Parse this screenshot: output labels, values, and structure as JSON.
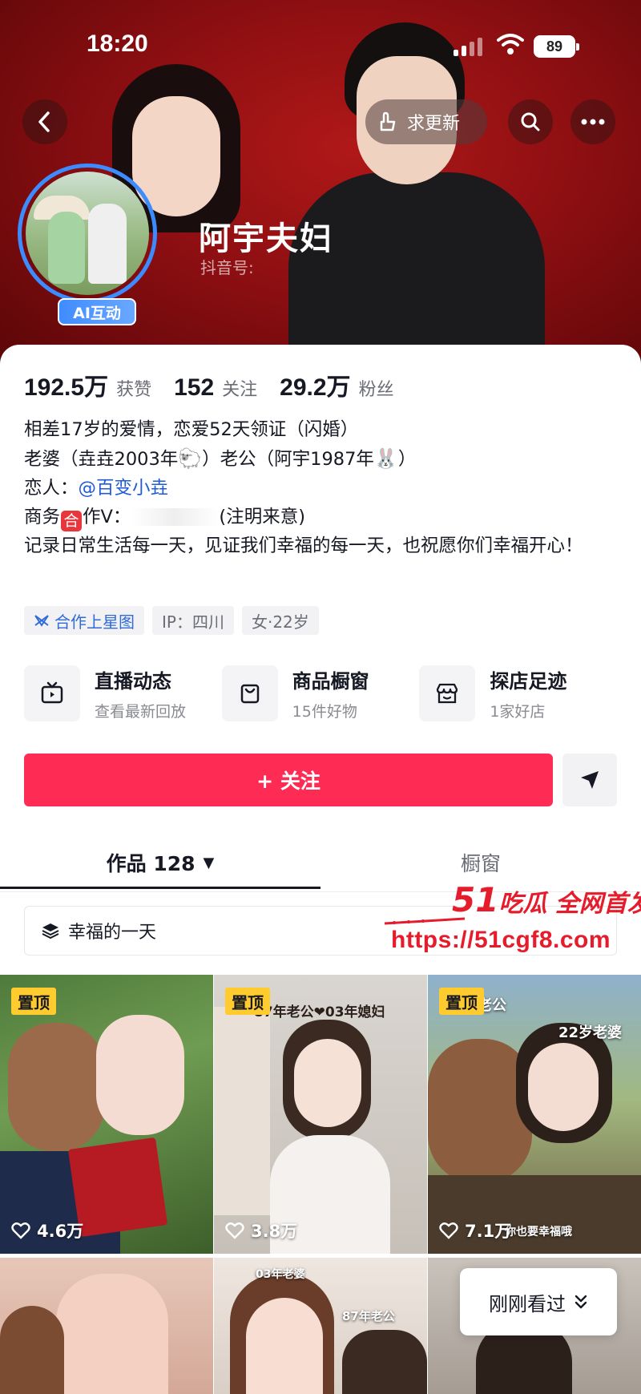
{
  "status_bar": {
    "time": "18:20",
    "battery": "89"
  },
  "top_nav": {
    "request_update_label": "求更新"
  },
  "profile": {
    "display_name": "阿宇夫妇",
    "douyin_id_label": "抖音号:",
    "avatar_badge": "AI互动"
  },
  "stats": [
    {
      "value": "192.5万",
      "label": "获赞"
    },
    {
      "value": "152",
      "label": "关注"
    },
    {
      "value": "29.2万",
      "label": "粉丝"
    }
  ],
  "bio": {
    "line1": "相差17岁的爱情，恋爱52天领证（闪婚）",
    "line2_a": "老婆（垚垚2003年",
    "line2_b": "）老公（阿宇1987年",
    "line2_c": "）",
    "line3_prefix": "恋人：",
    "line3_mention": "@百变小垚",
    "line4_a": "商务",
    "line4_badge": "合",
    "line4_b": "作V：",
    "line4_c": "(注明来意)",
    "line5": "记录日常生活每一天，见证我们幸福的每一天，也祝愿你们幸福开心！"
  },
  "tags": [
    {
      "label": "合作上星图",
      "icon": "star-map-icon"
    },
    {
      "label": "IP：四川"
    },
    {
      "label": "女·22岁"
    }
  ],
  "features": [
    {
      "title": "直播动态",
      "subtitle": "查看最新回放",
      "icon": "tv-icon"
    },
    {
      "title": "商品橱窗",
      "subtitle": "15件好物",
      "icon": "shopping-bag-icon"
    },
    {
      "title": "探店足迹",
      "subtitle": "1家好店",
      "icon": "store-icon"
    }
  ],
  "actions": {
    "follow_label": "+ 关注"
  },
  "tabs": {
    "works_label": "作品 128",
    "shop_label": "橱窗"
  },
  "collection": {
    "label": "幸福的一天"
  },
  "watermark": {
    "line1_num": "51",
    "line1_text": "吃瓜 全网首发",
    "line2": "https://51cgf8.com"
  },
  "videos": [
    {
      "pinned_label": "置顶",
      "likes": "4.6万"
    },
    {
      "pinned_label": "置顶",
      "likes": "3.8万",
      "caption": "87年老公❤03年媳妇"
    },
    {
      "pinned_label": "置顶",
      "likes": "7.1万",
      "caption_top": "老公",
      "caption_right": "22岁老婆",
      "caption_bottom": "你也要幸福哦"
    },
    {},
    {
      "caption_top": "03年老婆",
      "caption_right": "87年老公"
    },
    {}
  ],
  "recent_button": {
    "label": "刚刚看过"
  },
  "colors": {
    "accent": "#fe2c55",
    "pin": "#ffcb2f",
    "link": "#1f5bd6",
    "header_red": "#8e0f12",
    "watermark_red": "#e51c2b"
  }
}
